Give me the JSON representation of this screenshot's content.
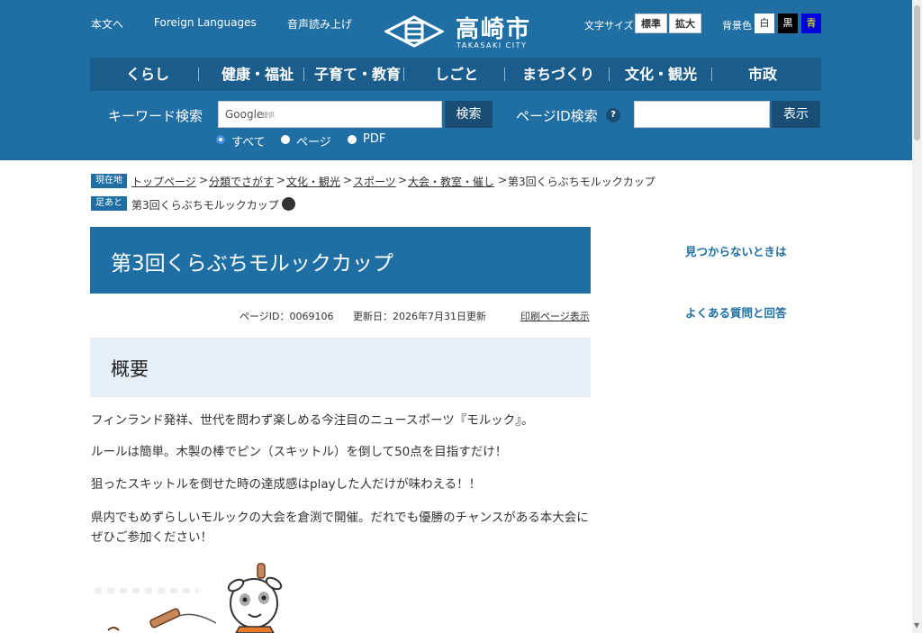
{
  "header": {
    "util_links": [
      "本文へ",
      "Foreign Languages",
      "音声読み上げ"
    ],
    "logo_name": "高崎市",
    "logo_sub": "TAKASAKI CITY",
    "font_size_label": "文字サイズ",
    "font_size_buttons": [
      "標準",
      "拡大"
    ],
    "bg_label": "背景色",
    "bg_buttons": [
      "白",
      "黒",
      "青"
    ]
  },
  "nav": [
    "くらし",
    "健康・福祉",
    "子育て・教育",
    "しごと",
    "まちづくり",
    "文化・観光",
    "市政"
  ],
  "search": {
    "keyword_label": "キーワード検索",
    "google_text": "Google",
    "google_sub": "提供",
    "keyword_button": "検索",
    "pageid_label": "ページID検索",
    "help_icon": "?",
    "pageid_button": "表示",
    "radios": [
      "すべて",
      "ページ",
      "PDF"
    ]
  },
  "breadcrumb": {
    "tag": "現在地",
    "items": [
      "トップページ",
      "分類でさがす",
      "文化・観光",
      "スポーツ",
      "大会・教室・催し"
    ],
    "separator": ">",
    "current": "第3回くらぶちモルックカップ"
  },
  "footprint": {
    "tag": "足あと",
    "item": "第3回くらぶちモルックカップ"
  },
  "page": {
    "title": "第3回くらぶちモルックカップ",
    "page_id": "ページID：0069106",
    "updated": "更新日：2026年7月31日更新",
    "print_link": "印刷ページ表示",
    "section_heading": "概要",
    "paragraphs": [
      "フィンランド発祥、世代を問わず楽しめる今注目のニュースポーツ『モルック』。",
      "ルールは簡単。木製の棒でピン（スキットル）を倒して50点を目指すだけ！",
      "狙ったスキットルを倒せた時の達成感はplayした人だけが味わえる！！",
      "県内でもめずらしいモルックの大会を倉渕で開催。だれでも優勝のチャンスがある本大会にぜひご参加ください！"
    ]
  },
  "sidebar": {
    "links": [
      "見つからないときは",
      "よくある質問と回答"
    ]
  },
  "colors": {
    "header_bg": "#1f6fa4",
    "nav_bg": "#1a5c8b",
    "section_bg": "#e6f0f8",
    "link": "#1f6fa4"
  }
}
